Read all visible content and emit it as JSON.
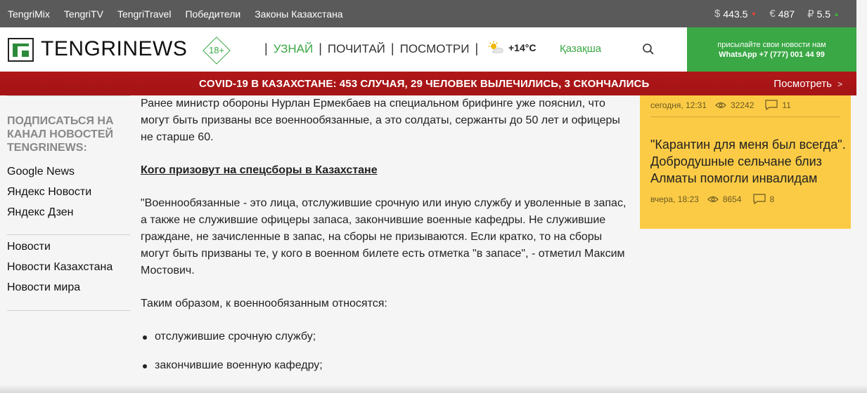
{
  "topbar": {
    "links": [
      "TengriMix",
      "TengriTV",
      "TengriTravel",
      "Победители",
      "Законы Казахстана"
    ],
    "rates": [
      {
        "currency": "$",
        "value": "443.5",
        "trend": "down"
      },
      {
        "currency": "€",
        "value": "487",
        "trend": ""
      },
      {
        "currency": "₽",
        "value": "5.5",
        "trend": "up"
      }
    ]
  },
  "header": {
    "logo_text": "TENGRINEWS",
    "age_rating": "18+",
    "nav": [
      "УЗНАЙ",
      "ПОЧИТАЙ",
      "ПОСМОТРИ"
    ],
    "weather_temp": "+14°C",
    "language": "Қазақша",
    "whatsapp_line1": "присылайте свои новости нам",
    "whatsapp_line2": "WhatsApp +7 (777) 001 44 99"
  },
  "banner": {
    "headline": "COVID-19 В КАЗАХСТАНЕ: 453 СЛУЧАЯ, 29 ЧЕЛОВЕК ВЫЛЕЧИЛИСЬ, 3 СКОНЧАЛИСЬ",
    "more": "Посмотреть"
  },
  "sidebar": {
    "subscribe": "ПОДПИСАТЬСЯ НА КАНАЛ НОВОСТЕЙ TENGRINEWS:",
    "channels": [
      "Google News",
      "Яндекс Новости",
      "Яндекс Дзен"
    ],
    "sections": [
      "Новости",
      "Новости Казахстана",
      "Новости мира"
    ]
  },
  "article": {
    "p1": "Ранее министр обороны Нурлан Ермекбаев на специальном брифинге уже пояснил, что могут быть призваны все военнообязанные, а это солдаты, сержанты до 50 лет и офицеры не старше 60.",
    "subheading": "Кого призовут на спецсборы в Казахстане",
    "p2": "\"Военнообязанные - это лица, отслужившие срочную или иную службу и уволенные в запас, а также не служившие офицеры запаса, закончившие военные кафедры. Не служившие граждане, не зачисленные в запас, на сборы не призываются. Если кратко, то на сборы могут быть призваны те, у кого в военном билете есть отметка \"в запасе\", - отметил Максим Мостович.",
    "p3": "Таким образом, к военнообязанным относятся:",
    "list": [
      "отслужившие срочную службу;",
      "закончившие военную кафедру;"
    ]
  },
  "right": {
    "item1": {
      "time": "сегодня, 12:31",
      "views": "32242",
      "comments": "11"
    },
    "item2": {
      "title": "\"Карантин для меня был всегда\". Добродушные сельчане близ Алматы помогли инвалидам",
      "time": "вчера, 18:23",
      "views": "8654",
      "comments": "8"
    }
  }
}
